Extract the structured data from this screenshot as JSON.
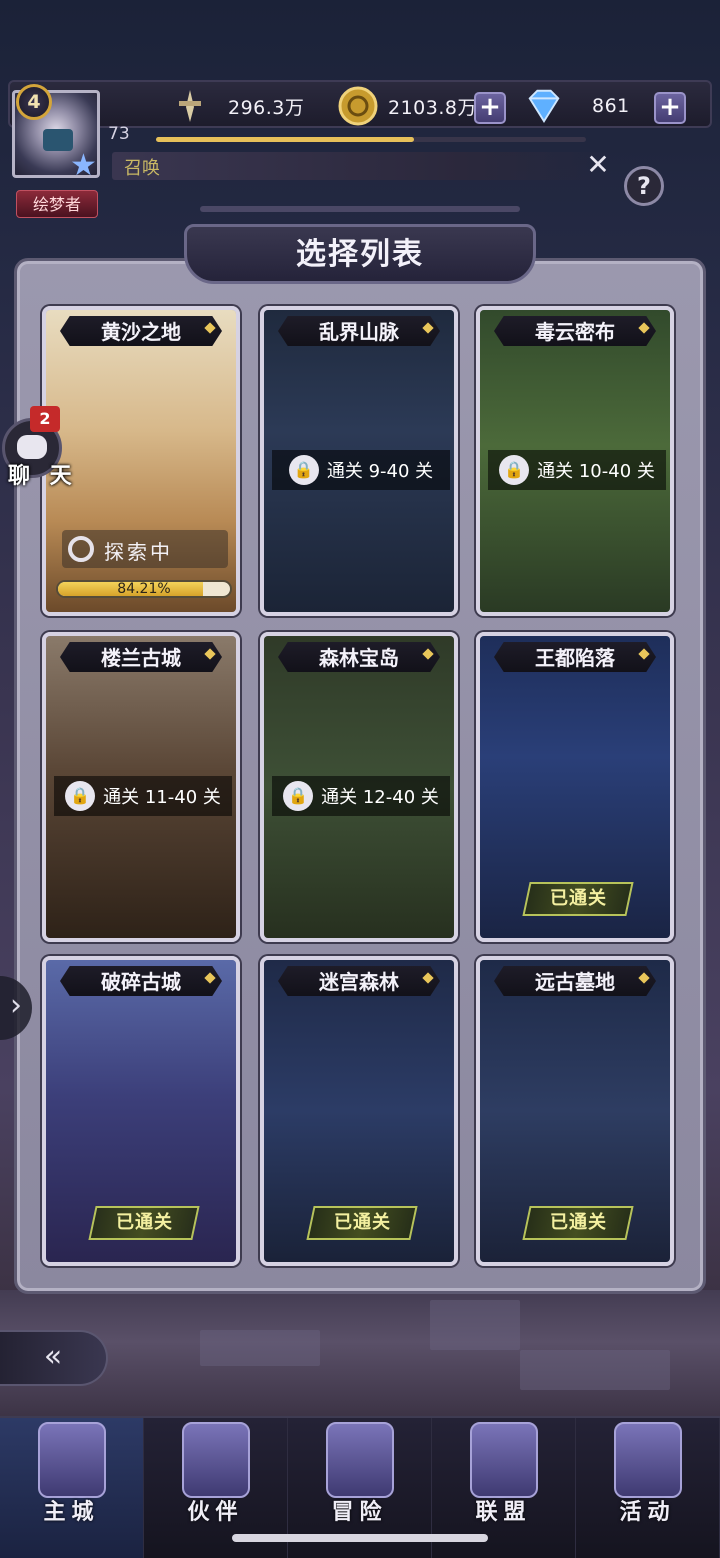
{
  "hud": {
    "player_level": "4",
    "title_badge": "绘梦者",
    "exp_level": "73",
    "exp_fraction": 0.6,
    "resources": {
      "power": {
        "icon": "sword-icon",
        "value": "296.3万"
      },
      "gold": {
        "icon": "gold-coin-icon",
        "value": "2103.8万"
      },
      "diamond": {
        "icon": "diamond-icon",
        "value": "861"
      }
    },
    "summon_text": "召唤",
    "help_label": "?",
    "close_label": "✕"
  },
  "panel": {
    "title": "选择列表"
  },
  "cards": [
    {
      "name": "黄沙之地",
      "state": "exploring",
      "explore_label": "探索中",
      "progress_text": "84.21%",
      "progress_fraction": 0.8421,
      "theme": "desert"
    },
    {
      "name": "乱界山脉",
      "state": "locked",
      "lock_text": "通关 9-40 关",
      "theme": "mountain"
    },
    {
      "name": "毒云密布",
      "state": "locked",
      "lock_text": "通关 10-40 关",
      "theme": "forest"
    },
    {
      "name": "楼兰古城",
      "state": "locked",
      "lock_text": "通关 11-40 关",
      "theme": "treasure"
    },
    {
      "name": "森林宝岛",
      "state": "locked",
      "lock_text": "通关 12-40 关",
      "theme": "jungle"
    },
    {
      "name": "王都陷落",
      "state": "cleared",
      "cleared_text": "已通关",
      "theme": "castle-blue"
    },
    {
      "name": "破碎古城",
      "state": "cleared",
      "cleared_text": "已通关",
      "theme": "castle-night"
    },
    {
      "name": "迷宫森林",
      "state": "cleared",
      "cleared_text": "已通关",
      "theme": "maze"
    },
    {
      "name": "远古墓地",
      "state": "cleared",
      "cleared_text": "已通关",
      "theme": "graveyard"
    }
  ],
  "side": {
    "chat_label": "聊 天",
    "chat_count": "2",
    "expand_arrow": "›",
    "back_arrow": "«"
  },
  "nav": [
    {
      "label": "主城",
      "icon": "castle-icon",
      "active": true
    },
    {
      "label": "伙伴",
      "icon": "companion-icon",
      "active": false
    },
    {
      "label": "冒险",
      "icon": "adventure-icon",
      "active": false
    },
    {
      "label": "联盟",
      "icon": "alliance-shield-icon",
      "active": false
    },
    {
      "label": "活动",
      "icon": "cards-icon",
      "active": false
    }
  ]
}
